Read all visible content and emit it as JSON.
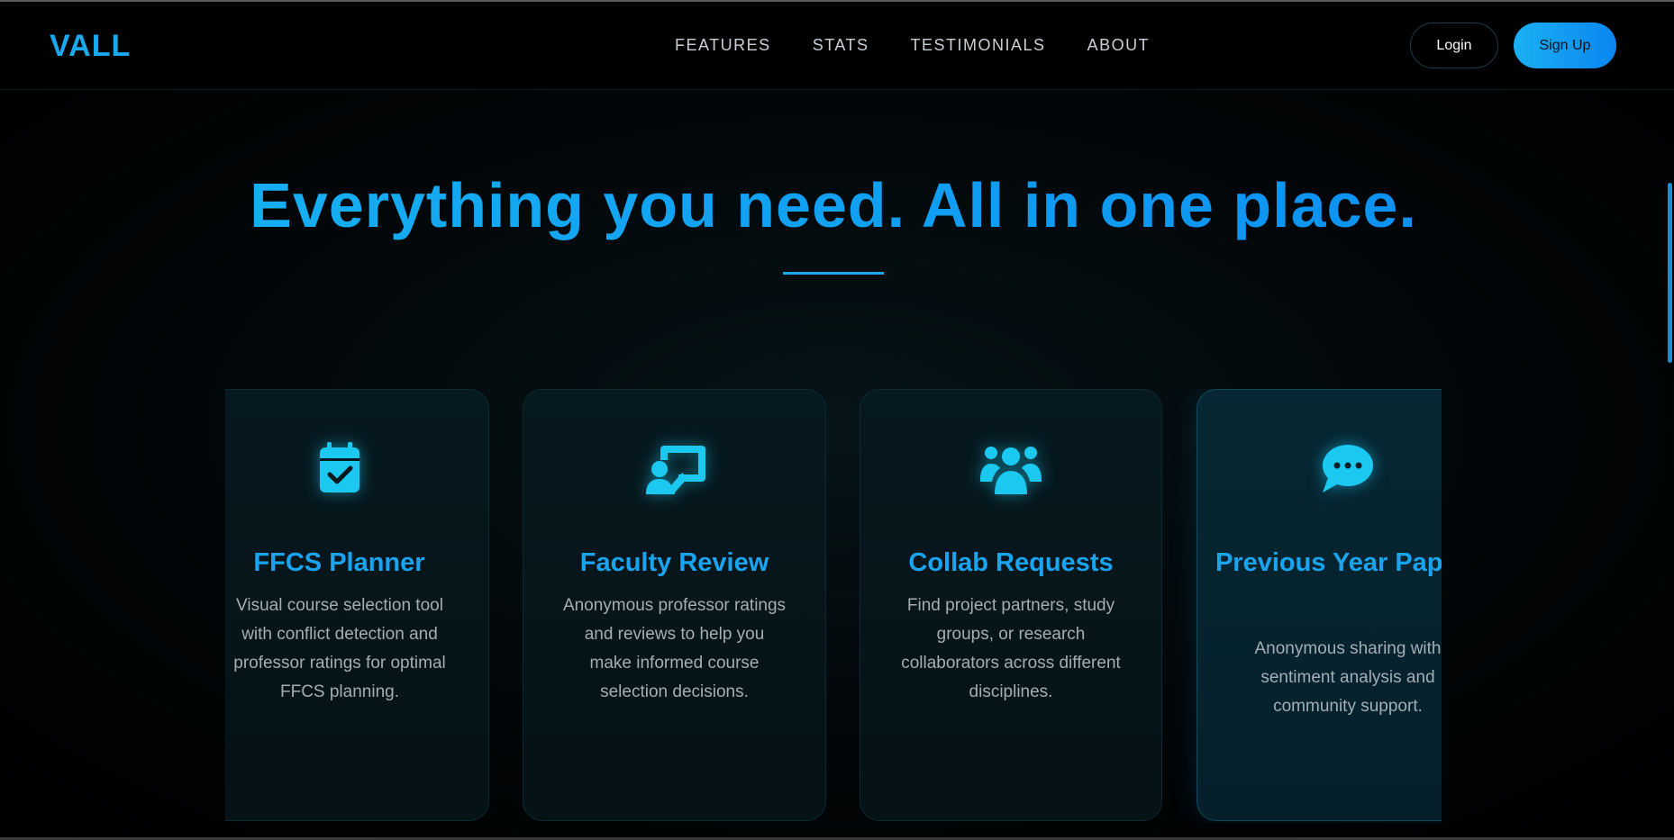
{
  "brand": {
    "logo": "VALL"
  },
  "nav": {
    "links": [
      "FEATURES",
      "STATS",
      "TESTIMONIALS",
      "ABOUT"
    ],
    "login_label": "Login",
    "signup_label": "Sign Up"
  },
  "hero": {
    "headline": "Everything you need. All in one place."
  },
  "features": [
    {
      "icon": "calendar-check-icon",
      "title": "FFCS Planner",
      "description": "Visual course selection tool with conflict detection and professor ratings for optimal FFCS planning."
    },
    {
      "icon": "chalkboard-teacher-icon",
      "title": "Faculty Review",
      "description": "Anonymous professor ratings and reviews to help you make informed course selection decisions."
    },
    {
      "icon": "users-icon",
      "title": "Collab Requests",
      "description": "Find project partners, study groups, or research collaborators across different disciplines."
    },
    {
      "icon": "comment-dots-icon",
      "title": "Previous Year Papers",
      "description": "Anonymous sharing with sentiment analysis and community support."
    }
  ],
  "colors": {
    "accent": "#19a9ef",
    "accent_gradient_end": "#0a86f0",
    "icon_cyan": "#1ac8f0",
    "background": "#000000",
    "card_bg": "#06191f",
    "muted_text": "#a4adb3"
  }
}
